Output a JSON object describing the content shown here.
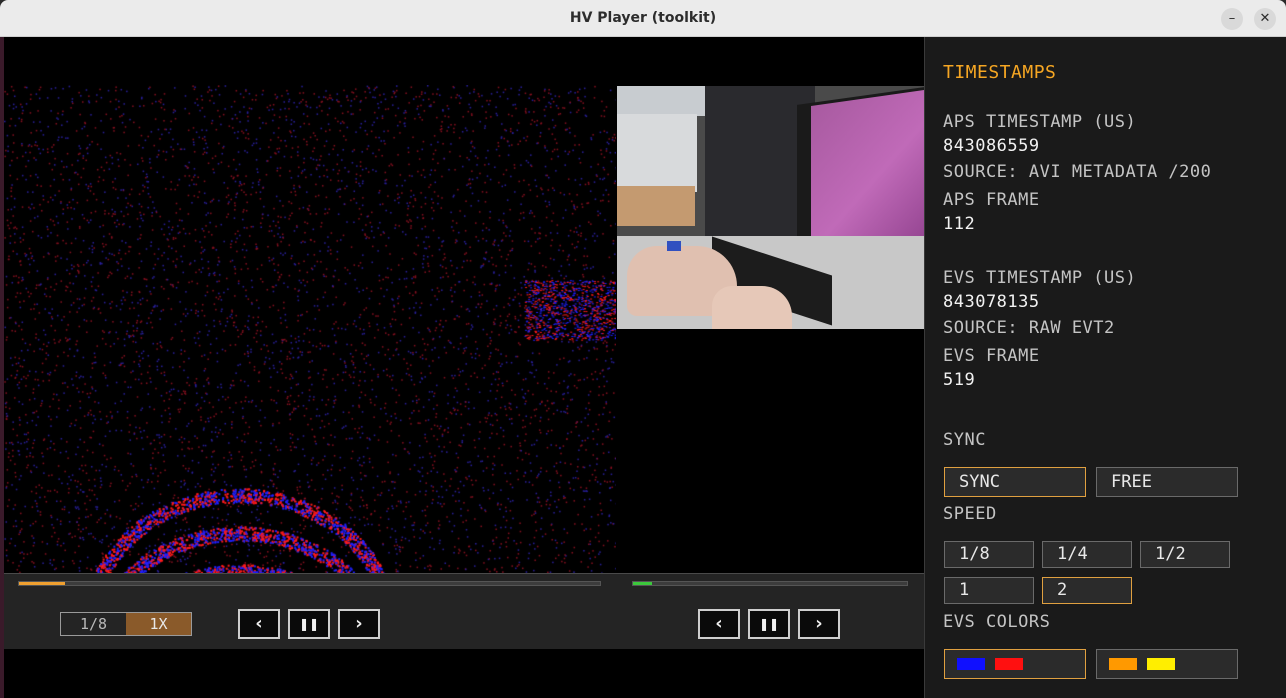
{
  "window": {
    "title": "HV Player (toolkit)",
    "minimize_glyph": "–",
    "close_glyph": "✕"
  },
  "playback": {
    "aps_progress": 0.08,
    "evs_progress": 0.07,
    "speed_options": [
      "1/8",
      "1X"
    ],
    "speed_selected": "1X",
    "prev_glyph": "‹",
    "pause_glyph": "❚❚",
    "next_glyph": "›"
  },
  "panel": {
    "heading": "TIMESTAMPS",
    "aps_timestamp_label": "APS TIMESTAMP (US)",
    "aps_timestamp_value": "843086559",
    "aps_source": "SOURCE: AVI METADATA /200",
    "aps_frame_label": "APS FRAME",
    "aps_frame_value": "112",
    "evs_timestamp_label": "EVS TIMESTAMP (US)",
    "evs_timestamp_value": "843078135",
    "evs_source": "SOURCE: RAW EVT2",
    "evs_frame_label": "EVS FRAME",
    "evs_frame_value": "519",
    "sync_heading": "SYNC",
    "sync_buttons": [
      "SYNC",
      "FREE"
    ],
    "sync_selected": "SYNC",
    "speed_heading": "SPEED",
    "speed_buttons": [
      "1/8",
      "1/4",
      "1/2",
      "1",
      "2"
    ],
    "speed_selected": "2",
    "evs_colors_heading": "EVS COLORS",
    "color_schemes": [
      {
        "name": "blue-red",
        "colors": [
          "#1010ff",
          "#ff1010"
        ],
        "selected": true
      },
      {
        "name": "orange-yellow",
        "colors": [
          "#ff9900",
          "#ffee00"
        ],
        "selected": false
      }
    ]
  },
  "colors": {
    "accent": "#f5a623",
    "evs_positive": "#ff1a1a",
    "evs_negative": "#2020ff",
    "aps_progress": "#f0a030",
    "evs_progress": "#3cc83c"
  }
}
